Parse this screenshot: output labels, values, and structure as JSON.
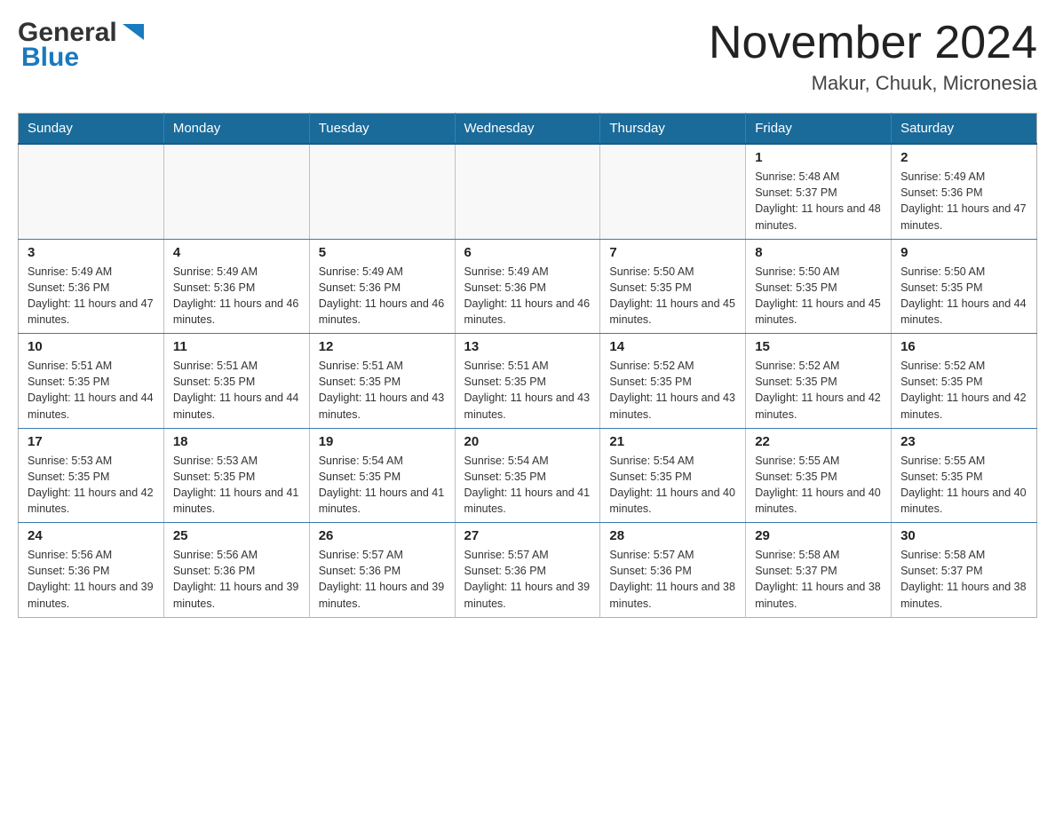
{
  "header": {
    "logo_general": "General",
    "logo_blue": "Blue",
    "title": "November 2024",
    "subtitle": "Makur, Chuuk, Micronesia"
  },
  "days_of_week": [
    "Sunday",
    "Monday",
    "Tuesday",
    "Wednesday",
    "Thursday",
    "Friday",
    "Saturday"
  ],
  "weeks": [
    [
      {
        "day": "",
        "sunrise": "",
        "sunset": "",
        "daylight": ""
      },
      {
        "day": "",
        "sunrise": "",
        "sunset": "",
        "daylight": ""
      },
      {
        "day": "",
        "sunrise": "",
        "sunset": "",
        "daylight": ""
      },
      {
        "day": "",
        "sunrise": "",
        "sunset": "",
        "daylight": ""
      },
      {
        "day": "",
        "sunrise": "",
        "sunset": "",
        "daylight": ""
      },
      {
        "day": "1",
        "sunrise": "Sunrise: 5:48 AM",
        "sunset": "Sunset: 5:37 PM",
        "daylight": "Daylight: 11 hours and 48 minutes."
      },
      {
        "day": "2",
        "sunrise": "Sunrise: 5:49 AM",
        "sunset": "Sunset: 5:36 PM",
        "daylight": "Daylight: 11 hours and 47 minutes."
      }
    ],
    [
      {
        "day": "3",
        "sunrise": "Sunrise: 5:49 AM",
        "sunset": "Sunset: 5:36 PM",
        "daylight": "Daylight: 11 hours and 47 minutes."
      },
      {
        "day": "4",
        "sunrise": "Sunrise: 5:49 AM",
        "sunset": "Sunset: 5:36 PM",
        "daylight": "Daylight: 11 hours and 46 minutes."
      },
      {
        "day": "5",
        "sunrise": "Sunrise: 5:49 AM",
        "sunset": "Sunset: 5:36 PM",
        "daylight": "Daylight: 11 hours and 46 minutes."
      },
      {
        "day": "6",
        "sunrise": "Sunrise: 5:49 AM",
        "sunset": "Sunset: 5:36 PM",
        "daylight": "Daylight: 11 hours and 46 minutes."
      },
      {
        "day": "7",
        "sunrise": "Sunrise: 5:50 AM",
        "sunset": "Sunset: 5:35 PM",
        "daylight": "Daylight: 11 hours and 45 minutes."
      },
      {
        "day": "8",
        "sunrise": "Sunrise: 5:50 AM",
        "sunset": "Sunset: 5:35 PM",
        "daylight": "Daylight: 11 hours and 45 minutes."
      },
      {
        "day": "9",
        "sunrise": "Sunrise: 5:50 AM",
        "sunset": "Sunset: 5:35 PM",
        "daylight": "Daylight: 11 hours and 44 minutes."
      }
    ],
    [
      {
        "day": "10",
        "sunrise": "Sunrise: 5:51 AM",
        "sunset": "Sunset: 5:35 PM",
        "daylight": "Daylight: 11 hours and 44 minutes."
      },
      {
        "day": "11",
        "sunrise": "Sunrise: 5:51 AM",
        "sunset": "Sunset: 5:35 PM",
        "daylight": "Daylight: 11 hours and 44 minutes."
      },
      {
        "day": "12",
        "sunrise": "Sunrise: 5:51 AM",
        "sunset": "Sunset: 5:35 PM",
        "daylight": "Daylight: 11 hours and 43 minutes."
      },
      {
        "day": "13",
        "sunrise": "Sunrise: 5:51 AM",
        "sunset": "Sunset: 5:35 PM",
        "daylight": "Daylight: 11 hours and 43 minutes."
      },
      {
        "day": "14",
        "sunrise": "Sunrise: 5:52 AM",
        "sunset": "Sunset: 5:35 PM",
        "daylight": "Daylight: 11 hours and 43 minutes."
      },
      {
        "day": "15",
        "sunrise": "Sunrise: 5:52 AM",
        "sunset": "Sunset: 5:35 PM",
        "daylight": "Daylight: 11 hours and 42 minutes."
      },
      {
        "day": "16",
        "sunrise": "Sunrise: 5:52 AM",
        "sunset": "Sunset: 5:35 PM",
        "daylight": "Daylight: 11 hours and 42 minutes."
      }
    ],
    [
      {
        "day": "17",
        "sunrise": "Sunrise: 5:53 AM",
        "sunset": "Sunset: 5:35 PM",
        "daylight": "Daylight: 11 hours and 42 minutes."
      },
      {
        "day": "18",
        "sunrise": "Sunrise: 5:53 AM",
        "sunset": "Sunset: 5:35 PM",
        "daylight": "Daylight: 11 hours and 41 minutes."
      },
      {
        "day": "19",
        "sunrise": "Sunrise: 5:54 AM",
        "sunset": "Sunset: 5:35 PM",
        "daylight": "Daylight: 11 hours and 41 minutes."
      },
      {
        "day": "20",
        "sunrise": "Sunrise: 5:54 AM",
        "sunset": "Sunset: 5:35 PM",
        "daylight": "Daylight: 11 hours and 41 minutes."
      },
      {
        "day": "21",
        "sunrise": "Sunrise: 5:54 AM",
        "sunset": "Sunset: 5:35 PM",
        "daylight": "Daylight: 11 hours and 40 minutes."
      },
      {
        "day": "22",
        "sunrise": "Sunrise: 5:55 AM",
        "sunset": "Sunset: 5:35 PM",
        "daylight": "Daylight: 11 hours and 40 minutes."
      },
      {
        "day": "23",
        "sunrise": "Sunrise: 5:55 AM",
        "sunset": "Sunset: 5:35 PM",
        "daylight": "Daylight: 11 hours and 40 minutes."
      }
    ],
    [
      {
        "day": "24",
        "sunrise": "Sunrise: 5:56 AM",
        "sunset": "Sunset: 5:36 PM",
        "daylight": "Daylight: 11 hours and 39 minutes."
      },
      {
        "day": "25",
        "sunrise": "Sunrise: 5:56 AM",
        "sunset": "Sunset: 5:36 PM",
        "daylight": "Daylight: 11 hours and 39 minutes."
      },
      {
        "day": "26",
        "sunrise": "Sunrise: 5:57 AM",
        "sunset": "Sunset: 5:36 PM",
        "daylight": "Daylight: 11 hours and 39 minutes."
      },
      {
        "day": "27",
        "sunrise": "Sunrise: 5:57 AM",
        "sunset": "Sunset: 5:36 PM",
        "daylight": "Daylight: 11 hours and 39 minutes."
      },
      {
        "day": "28",
        "sunrise": "Sunrise: 5:57 AM",
        "sunset": "Sunset: 5:36 PM",
        "daylight": "Daylight: 11 hours and 38 minutes."
      },
      {
        "day": "29",
        "sunrise": "Sunrise: 5:58 AM",
        "sunset": "Sunset: 5:37 PM",
        "daylight": "Daylight: 11 hours and 38 minutes."
      },
      {
        "day": "30",
        "sunrise": "Sunrise: 5:58 AM",
        "sunset": "Sunset: 5:37 PM",
        "daylight": "Daylight: 11 hours and 38 minutes."
      }
    ]
  ]
}
